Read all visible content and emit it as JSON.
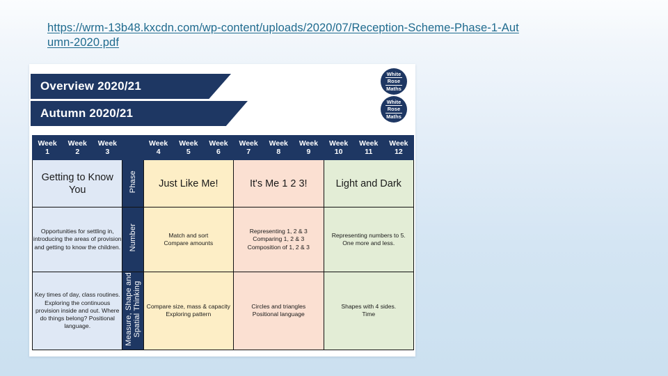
{
  "page": {
    "background_top": "#fbfdfe",
    "background_bottom": "#cbe0f0"
  },
  "url_bar": {
    "link_text": "https://wrm-13b48.kxcdn.com/wp-content/uploads/2020/07/Reception-Scheme-Phase-1-Autumn-2020.pdf",
    "color": "#1f6b8e"
  },
  "document": {
    "banners": [
      {
        "label": "Overview 2020/21"
      },
      {
        "label": "Autumn 2020/21"
      }
    ],
    "logo": {
      "line1": "White",
      "line2": "Rose",
      "line3": "Maths",
      "color": "#1e3763",
      "count": 2
    },
    "table": {
      "week_headers": [
        {
          "top": "Week",
          "num": "1"
        },
        {
          "top": "Week",
          "num": "2"
        },
        {
          "top": "Week",
          "num": "3"
        },
        {
          "top": "",
          "num": ""
        },
        {
          "top": "Week",
          "num": "4"
        },
        {
          "top": "Week",
          "num": "5"
        },
        {
          "top": "Week",
          "num": "6"
        },
        {
          "top": "Week",
          "num": "7"
        },
        {
          "top": "Week",
          "num": "8"
        },
        {
          "top": "Week",
          "num": "9"
        },
        {
          "top": "Week",
          "num": "10"
        },
        {
          "top": "Week",
          "num": "11"
        },
        {
          "top": "Week",
          "num": "12"
        }
      ],
      "row_labels": [
        "Phase",
        "Number",
        "Measure, Shape and\nSpatial Thinking"
      ],
      "rows": [
        {
          "label": "Phase",
          "intro": "Getting to Know You",
          "cells": [
            "Just Like Me!",
            "It's Me 1 2 3!",
            "Light and Dark"
          ]
        },
        {
          "label": "Number",
          "intro": "Opportunities for settling in, introducing the areas of provision and getting to know the children.",
          "cells": [
            "Match and sort\nCompare amounts",
            "Representing 1, 2 & 3\nComparing 1, 2 & 3\nComposition of 1, 2 & 3",
            "Representing numbers to 5.\nOne more and less."
          ]
        },
        {
          "label": "Measure, Shape and Spatial Thinking",
          "intro": "Key times of day, class routines. Exploring the continuous provision inside and out. Where do things belong? Positional language.",
          "cells": [
            "Compare size, mass & capacity\nExploring pattern",
            "Circles and triangles\nPositional language",
            "Shapes with 4 sides.\nTime"
          ]
        }
      ],
      "colors": {
        "header": "#1e3763",
        "intro": "#dfe8f5",
        "block1": "#fdeec6",
        "block2": "#fbe0d2",
        "block3": "#e3edd6"
      }
    }
  }
}
